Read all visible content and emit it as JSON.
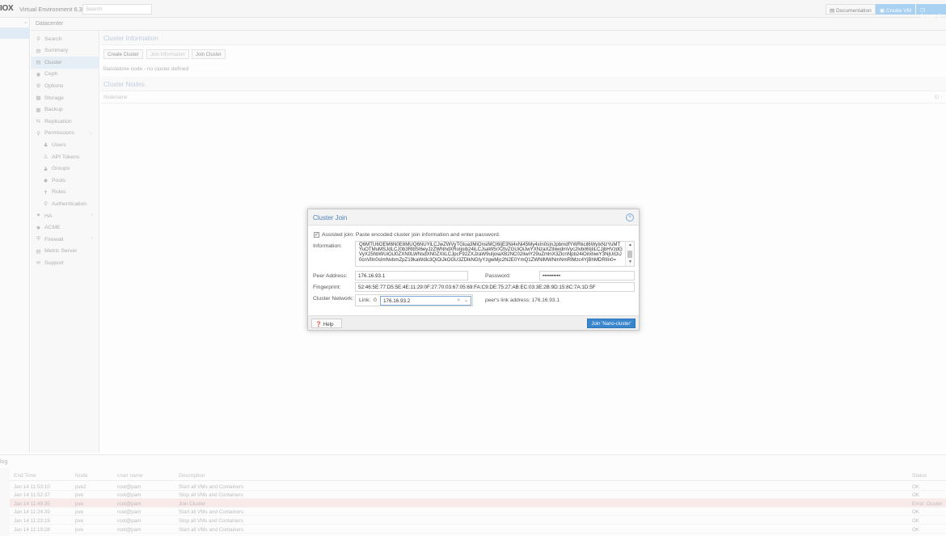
{
  "topbar": {
    "logo": "IOX",
    "title": "Virtual Environment 6.3-2",
    "search_placeholder": "Search",
    "documentation": "Documentation",
    "create_vm": "Create VM",
    "create_ct": "Create C"
  },
  "header": {
    "breadcrumb": "Datacenter"
  },
  "menu": {
    "items": [
      {
        "label": "Search",
        "icon": "search-icon"
      },
      {
        "label": "Summary",
        "icon": "book-icon"
      },
      {
        "label": "Cluster",
        "icon": "server-icon"
      },
      {
        "label": "Ceph",
        "icon": "ceph-icon"
      },
      {
        "label": "Options",
        "icon": "gear-icon"
      },
      {
        "label": "Storage",
        "icon": "database-icon"
      },
      {
        "label": "Backup",
        "icon": "floppy-icon"
      },
      {
        "label": "Replication",
        "icon": "retweet-icon"
      },
      {
        "label": "Permissions",
        "icon": "unlock-icon"
      },
      {
        "label": "Users",
        "icon": "user-icon"
      },
      {
        "label": "API Tokens",
        "icon": "user-outline-icon"
      },
      {
        "label": "Groups",
        "icon": "users-icon"
      },
      {
        "label": "Pools",
        "icon": "tags-icon"
      },
      {
        "label": "Roles",
        "icon": "male-icon"
      },
      {
        "label": "Authentication",
        "icon": "key-icon"
      },
      {
        "label": "HA",
        "icon": "heartbeat-icon"
      },
      {
        "label": "ACME",
        "icon": "certificate-icon"
      },
      {
        "label": "Firewall",
        "icon": "shield-icon"
      },
      {
        "label": "Metric Server",
        "icon": "chart-icon"
      },
      {
        "label": "Support",
        "icon": "comments-icon"
      }
    ]
  },
  "content": {
    "cluster_info_title": "Cluster Information",
    "create_cluster": "Create Cluster",
    "join_information": "Join Information",
    "join_cluster": "Join Cluster",
    "standalone": "Standalone node - no cluster defined",
    "cluster_nodes_title": "Cluster Nodes",
    "col_nodename": "Nodename",
    "col_id": "ID ↑"
  },
  "dialog": {
    "title": "Cluster Join",
    "assisted_label": "Assisted join: Paste encoded cluster join information and enter password.",
    "information_label": "Information:",
    "information_value": "Q6MTU6OEM6N0E6MUQ6NUYiLCJwZWVyTGlua3MiOnsiMCI6IjE3Ni4xNi45My4xIn0sInJpbmdfYWRkcil6WylxNzYuMTYuOTMuMSJdLCJ0b3RlbSI6eyJzZWNhdXRoIjoib24iLCJsaW5rX2tvZGUiOiJwYXNzaXZlIiwidmVyc2lvbiI6IjIiLCJjbHVzdGVyX25hbWUiOiJ0ZXN0LWNsdXN0ZXIiLCJpcF92ZXJzaW9uIjoiaXB2NC02IiwiY29uZmlnX3ZlcnNpb24iOiIxIiwiY3NjUiOiJ0cnVlIn0sImNvbmZpZ19kaWdlc3QiOiJkOGU3ZDlkNGIyYzgwMjc2N2E0YmQ1ZWNlMWNmNmRlMzc4YjBhMDRlIn0=",
    "peer_address_label": "Peer Address:",
    "peer_address_value": "176.16.93.1",
    "password_label": "Password:",
    "password_value": "••••••••••",
    "fingerprint_label": "Fingerprint:",
    "fingerprint_value": "52:46:5E:77:D5:5E:4E:11:29:0F:27:70:03:67:05:69:FA:C9:DE:75:27:AB:EC:03:3E:2B:9D:15:8C:7A:1D:5F",
    "cluster_network_label": "Cluster Network:",
    "link_label": "Link:",
    "link_number": "0",
    "link_value": "176.16.93.2",
    "peer_link_label": "peer's link address: 176.16.93.1",
    "help": "Help",
    "join_button": "Join 'Nano-cluster'"
  },
  "tasklog": {
    "title": "log",
    "columns": [
      "End Time",
      "Node",
      "User name",
      "Description",
      "Status"
    ],
    "rows": [
      {
        "end": "Jan 14 11:53:10",
        "node": "pve2",
        "user": "root@pam",
        "desc": "Start all VMs and Containers",
        "status": "OK",
        "error": false
      },
      {
        "end": "Jan 14 11:52:37",
        "node": "pve",
        "user": "root@pam",
        "desc": "Stop all VMs and Containers",
        "status": "OK",
        "error": false
      },
      {
        "end": "Jan 14 11:49:35",
        "node": "pve",
        "user": "root@pam",
        "desc": "Join Cluster",
        "status": "Error: Cluster",
        "error": true
      },
      {
        "end": "Jan 14 11:24:39",
        "node": "pve",
        "user": "root@pam",
        "desc": "Start all VMs and Containers",
        "status": "OK",
        "error": false
      },
      {
        "end": "Jan 14 11:23:19",
        "node": "pve",
        "user": "root@pam",
        "desc": "Stop all VMs and Containers",
        "status": "OK",
        "error": false
      },
      {
        "end": "Jan 14 11:19:28",
        "node": "pve",
        "user": "root@pam",
        "desc": "Start all VMs and Containers",
        "status": "OK",
        "error": false
      }
    ]
  }
}
